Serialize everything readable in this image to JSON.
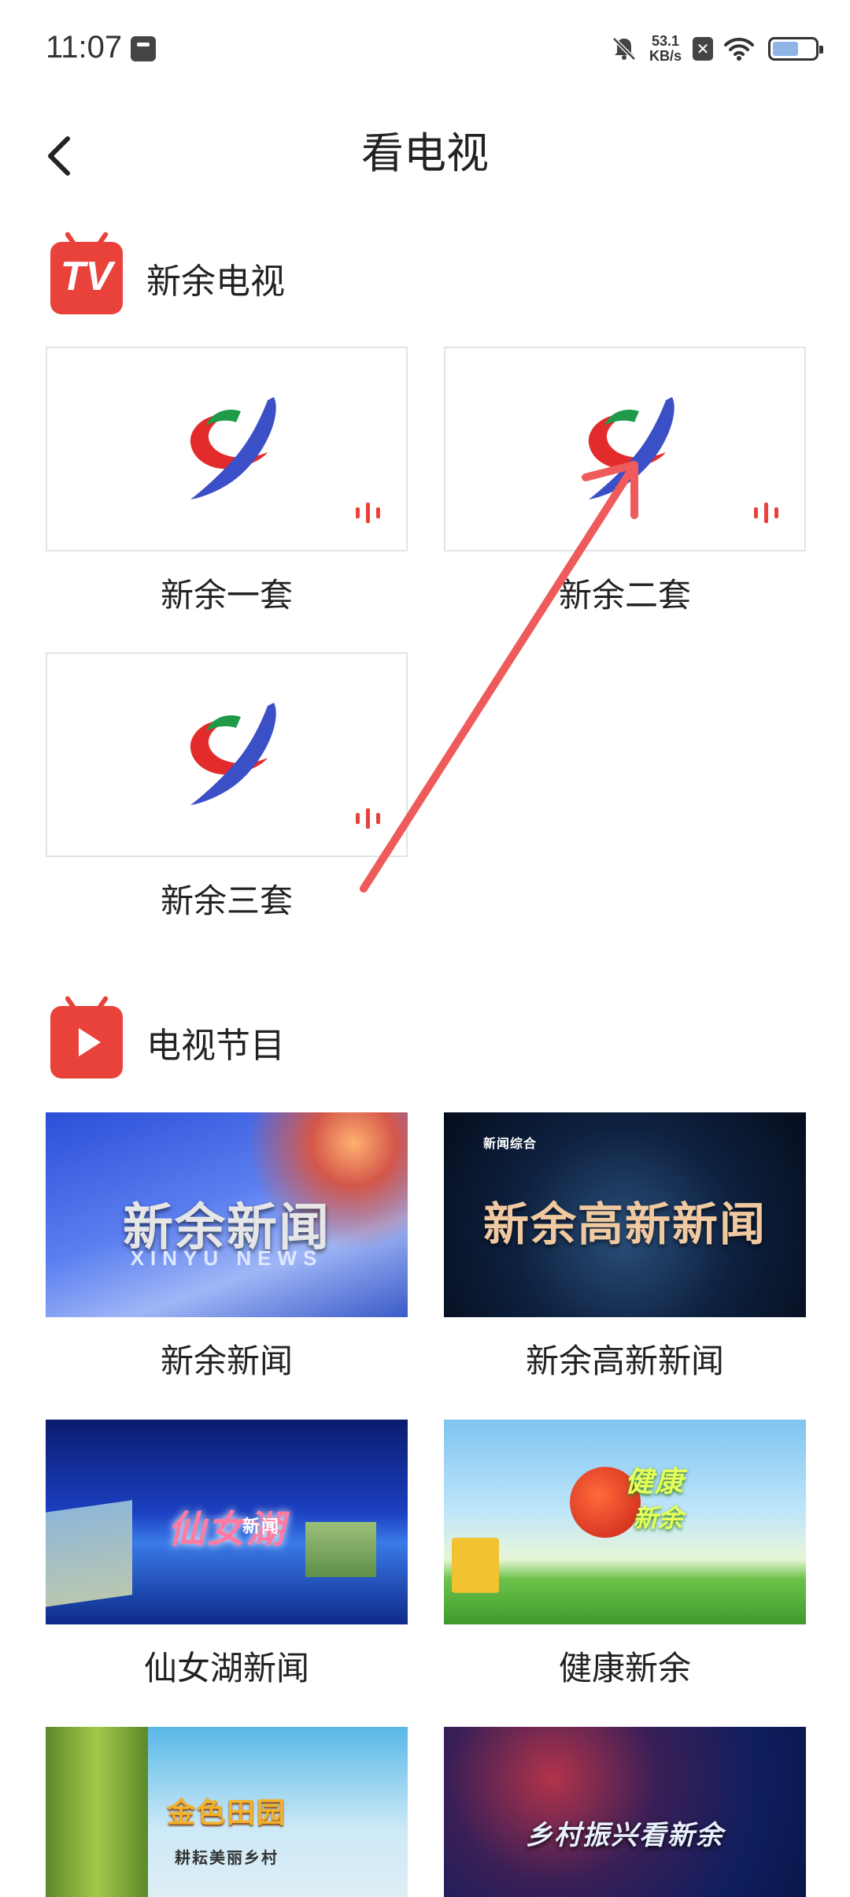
{
  "status_bar": {
    "time": "11:07",
    "net_speed_value": "53.1",
    "net_speed_unit": "KB/s",
    "battery_icon": "battery-icon"
  },
  "header": {
    "title": "看电视",
    "back_icon": "chevron-left-icon"
  },
  "tv_section": {
    "icon_text": "TV",
    "title": "新余电视",
    "channels": [
      {
        "label": "新余一套"
      },
      {
        "label": "新余二套"
      },
      {
        "label": "新余三套"
      }
    ]
  },
  "program_section": {
    "title": "电视节目",
    "programs": [
      {
        "label": "新余新闻",
        "caption": "新余新闻",
        "sub": "XINYU NEWS"
      },
      {
        "label": "新余高新新闻",
        "caption": "新余高新新闻",
        "sub": "新闻综合"
      },
      {
        "label": "仙女湖新闻",
        "caption": "仙女湖",
        "sub": "新闻"
      },
      {
        "label": "健康新余",
        "caption": "健康",
        "sub": "新余"
      },
      {
        "label": "",
        "caption": "金色田园",
        "sub": "耕耘美丽乡村"
      },
      {
        "label": "",
        "caption": "乡村振兴看新余",
        "sub": ""
      }
    ]
  },
  "colors": {
    "accent_red": "#e8423a",
    "annotation_arrow": "#ef5a5a"
  }
}
